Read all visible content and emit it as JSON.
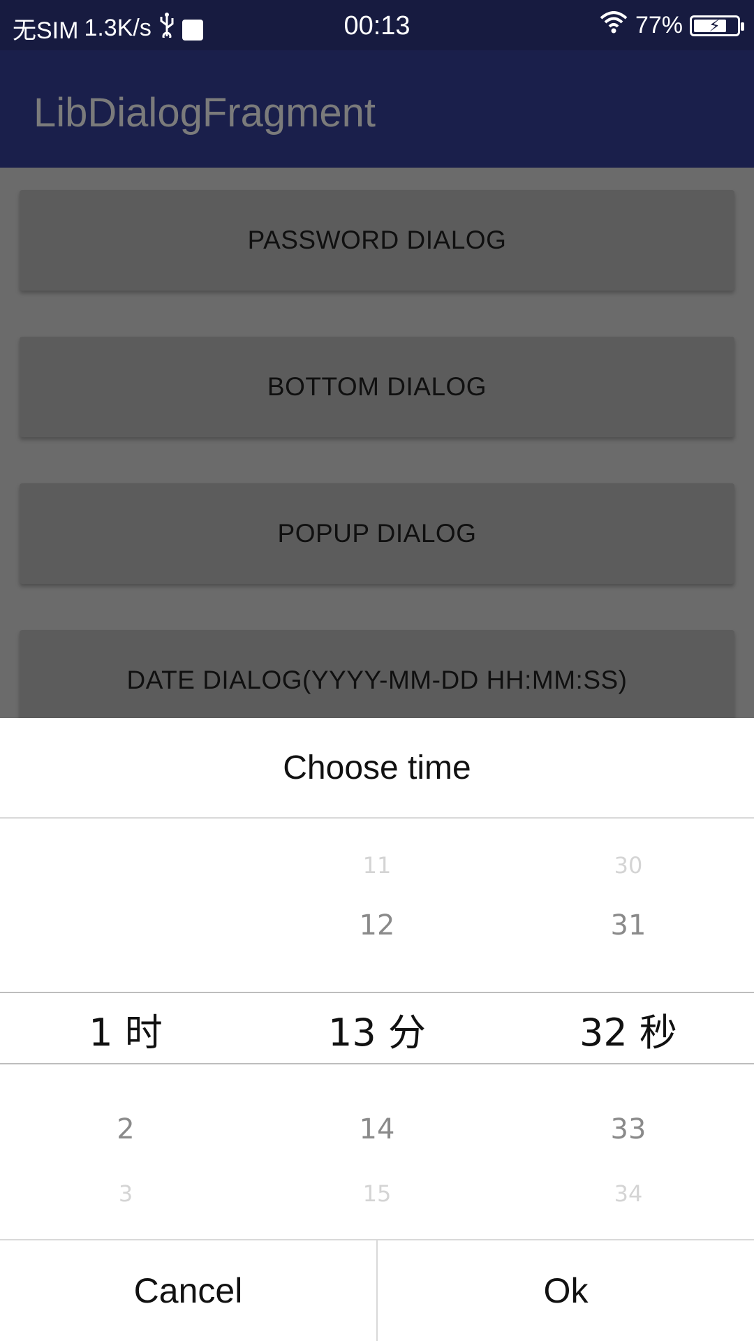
{
  "status_bar": {
    "carrier": "无SIM",
    "speed": "1.3K/s",
    "time": "00:13",
    "battery_percent": "77%",
    "battery_level": 0.77
  },
  "app_bar": {
    "title": "LibDialogFragment"
  },
  "main": {
    "buttons": [
      {
        "label": "PASSWORD DIALOG"
      },
      {
        "label": "BOTTOM DIALOG"
      },
      {
        "label": "POPUP DIALOG"
      },
      {
        "label": "DATE DIALOG(YYYY-MM-DD HH:MM:SS)"
      }
    ]
  },
  "dialog": {
    "title": "Choose time",
    "hours": {
      "selected": "1  时",
      "after1": "2",
      "after2": "3"
    },
    "minutes": {
      "before2": "11",
      "before1": "12",
      "selected": "13 分",
      "after1": "14",
      "after2": "15"
    },
    "seconds": {
      "before2": "30",
      "before1": "31",
      "selected": "32 秒",
      "after1": "33",
      "after2": "34"
    },
    "cancel_label": "Cancel",
    "ok_label": "Ok"
  }
}
